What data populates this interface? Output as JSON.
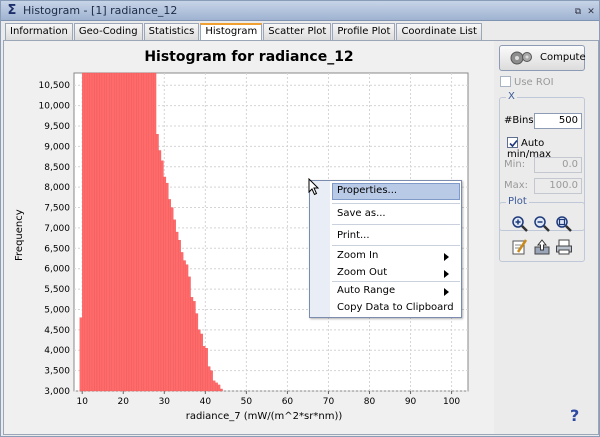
{
  "window": {
    "title": "Histogram - [1] radiance_12",
    "icon": "sigma-icon"
  },
  "tabs": [
    {
      "label": "Information"
    },
    {
      "label": "Geo-Coding"
    },
    {
      "label": "Statistics"
    },
    {
      "label": "Histogram",
      "active": true
    },
    {
      "label": "Scatter Plot"
    },
    {
      "label": "Profile Plot"
    },
    {
      "label": "Coordinate List"
    }
  ],
  "chart_data": {
    "type": "bar",
    "title": "Histogram for radiance_12",
    "xlabel": "radiance_7 (mW/(m^2*sr*nm))",
    "ylabel": "Frequency",
    "xlim": [
      8,
      104
    ],
    "ylim": [
      3000,
      10800
    ],
    "x_ticks": [
      10,
      20,
      30,
      40,
      50,
      60,
      70,
      80,
      90,
      100
    ],
    "y_ticks": [
      "3,000",
      "3,500",
      "4,000",
      "4,500",
      "5,000",
      "5,500",
      "6,000",
      "6,500",
      "7,000",
      "7,500",
      "8,000",
      "8,500",
      "9,000",
      "9,500",
      "10,000",
      "10,500"
    ],
    "y_tick_values": [
      3000,
      3500,
      4000,
      4500,
      5000,
      5500,
      6000,
      6500,
      7000,
      7500,
      8000,
      8500,
      9000,
      9500,
      10000,
      10500
    ],
    "grid": true,
    "bar_color": "#ff6a6a",
    "bin_width": 0.6,
    "series": [
      {
        "x": [
          9.7,
          10.3,
          10.9,
          11.5,
          12.1,
          12.7,
          13.3,
          13.9,
          14.5,
          15.1,
          15.7,
          16.3,
          16.9,
          17.5,
          18.1,
          18.7,
          19.3,
          19.9,
          20.5,
          21.1,
          21.7,
          22.3,
          22.9,
          23.5,
          24.1,
          24.7,
          25.3,
          25.9,
          26.5,
          27.1,
          27.7,
          28.3,
          28.9,
          29.5,
          30.1,
          30.7,
          31.3,
          31.9,
          32.5,
          33.1,
          33.7,
          34.3,
          34.9,
          35.5,
          36.1,
          36.7,
          37.3,
          37.9,
          38.5,
          39.1,
          39.7,
          40.3,
          40.9,
          41.5,
          42.1,
          42.7,
          43.3,
          43.9
        ],
        "values": [
          4800,
          10800,
          10800,
          10800,
          10800,
          10800,
          10800,
          10800,
          10800,
          10800,
          10800,
          10800,
          10800,
          10800,
          10800,
          10800,
          10800,
          10800,
          10800,
          10800,
          10800,
          10800,
          10800,
          10800,
          10800,
          10800,
          10800,
          10800,
          10800,
          10800,
          10800,
          9300,
          8900,
          8650,
          8250,
          8100,
          7700,
          7500,
          7200,
          6900,
          6700,
          6400,
          6200,
          6100,
          5800,
          5300,
          5200,
          4900,
          4500,
          4400,
          4100,
          4050,
          3600,
          3500,
          3250,
          3200,
          3150,
          3050
        ]
      }
    ]
  },
  "context_menu": {
    "items": [
      {
        "label": "Properties...",
        "selected": true
      },
      {
        "label": "Save as..."
      },
      {
        "label": "Print..."
      },
      {
        "label": "Zoom In",
        "submenu": true
      },
      {
        "label": "Zoom Out",
        "submenu": true
      },
      {
        "label": "Auto Range",
        "submenu": true
      },
      {
        "label": "Copy Data to Clipboard"
      }
    ]
  },
  "controls": {
    "compute_label": "Compute",
    "use_roi_label": "Use ROI",
    "use_roi_checked": false,
    "x_group": {
      "title": "X",
      "bins_label": "#Bins:",
      "bins_value": "500",
      "auto_minmax_label": "Auto min/max",
      "auto_minmax_checked": true,
      "min_label": "Min:",
      "min_value": "0.0",
      "max_label": "Max:",
      "max_value": "100.0"
    },
    "plot_group": {
      "title": "Plot",
      "icons": [
        "zoom-in-icon",
        "zoom-out-icon",
        "zoom-all-icon",
        "edit-properties-icon",
        "export-icon",
        "print-icon"
      ]
    },
    "help_label": "?"
  }
}
